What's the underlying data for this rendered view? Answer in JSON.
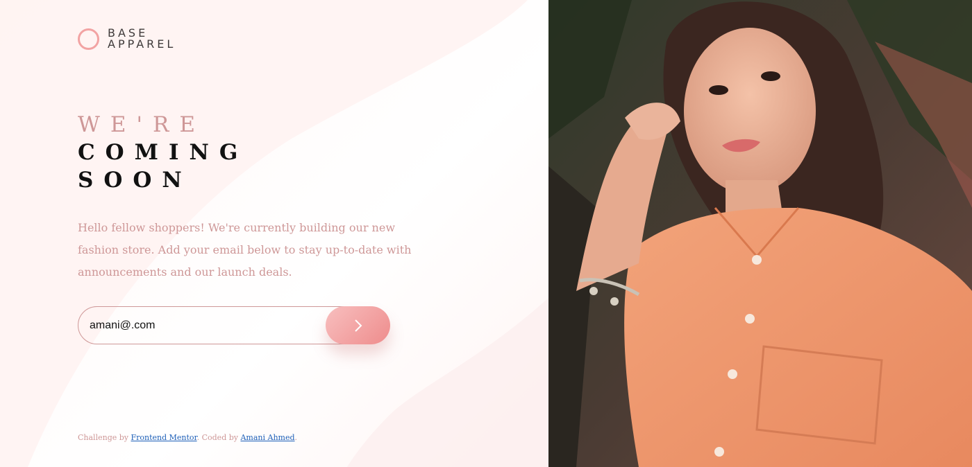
{
  "logo": {
    "line1": "BASE",
    "line2": "APPAREL",
    "accent_color": "#f2a3a3"
  },
  "headline": {
    "light": "WE'RE",
    "dark1": "COMING",
    "dark2": "SOON"
  },
  "intro": "Hello fellow shoppers! We're currently building our new fashion store. Add your email below to stay up-to-date with announcements and our launch deals.",
  "form": {
    "email_value": "amani@.com",
    "submit_icon": "chevron-right-icon"
  },
  "footer": {
    "prefix": "Challenge by ",
    "link1": "Frontend Mentor",
    "middle": ". Coded by ",
    "link2": "Amani Ahmed",
    "suffix": "."
  },
  "hero_image": {
    "icon": "portrait-photo"
  },
  "colors": {
    "desaturated_red": "#ce9797",
    "dark_text": "#3d3232",
    "gradient_start": "#f8bfbf",
    "gradient_end": "#ee8c8c"
  }
}
